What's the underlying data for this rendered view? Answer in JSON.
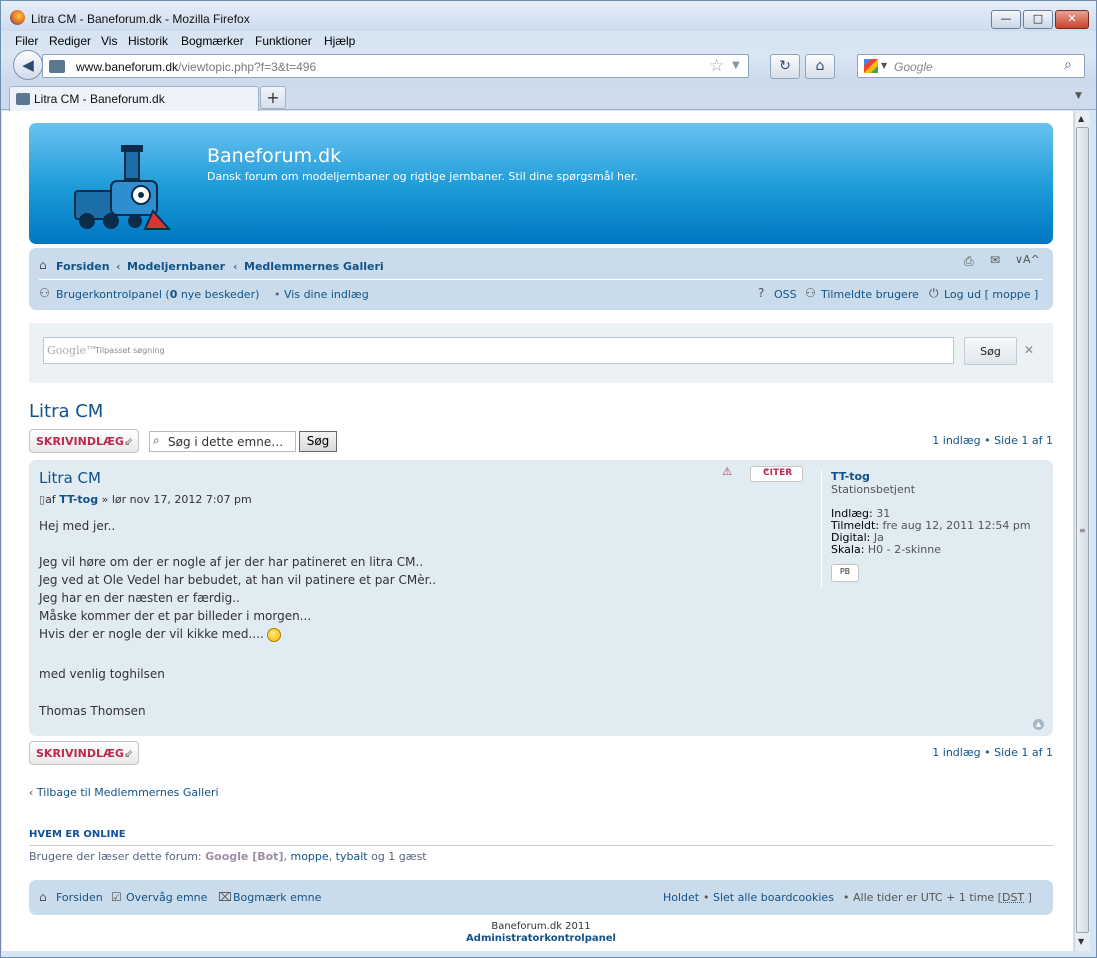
{
  "window": {
    "title": "Litra CM - Baneforum.dk - Mozilla Firefox",
    "min": "—",
    "max": "□",
    "close": "✕"
  },
  "menu": {
    "items": [
      "Filer",
      "Rediger",
      "Vis",
      "Historik",
      "Bogmærker",
      "Funktioner",
      "Hjælp"
    ]
  },
  "nav": {
    "back": "◀",
    "url_domain": "www.baneforum.dk",
    "url_path": "/viewtopic.php?f=3&t=496",
    "reload": "↻",
    "home": "⌂",
    "search_placeholder": "Google"
  },
  "tabs": {
    "active_label": "Litra CM - Baneforum.dk",
    "new_tab": "+"
  },
  "header": {
    "site_name": "Baneforum.dk",
    "site_desc": "Dansk forum om modeljernbaner og rigtige jernbaner. Stil dine spørgsmål her."
  },
  "breadcrumb": {
    "home": "Forsiden",
    "sep": "‹",
    "cat": "Modeljernbaner",
    "forum": "Medlemmernes Galleri"
  },
  "navlinks": {
    "ucp_pre": "Brugerkontrolpanel (",
    "ucp_count": "0",
    "ucp_post": " nye beskeder)",
    "bullet": "•",
    "own_posts": "Vis dine indlæg",
    "faq": "OSS",
    "members": "Tilmeldte brugere",
    "logout": "Log ud [ moppe ]"
  },
  "gsearch": {
    "brand": "Google™",
    "placeholder": "Tilpasset søgning",
    "button": "Søg",
    "clear": "✕"
  },
  "topic": {
    "title": "Litra CM"
  },
  "post_button": "SKRIVINDLÆG",
  "topic_search": {
    "value": "Søg i dette emne…",
    "button": "Søg"
  },
  "pagination": "1 indlæg • Side 1 af 1",
  "post": {
    "title": "Litra CM",
    "meta_pre": "af",
    "author": "TT-tog",
    "meta_post": "» lør nov 17, 2012 7:07 pm",
    "quote_label": "CITER",
    "lines": [
      "Hej med jer..",
      "Jeg vil høre om der er nogle af jer der har patineret en litra CM..",
      "Jeg ved at Ole Vedel har bebudet, at han vil patinere et par CMèr..",
      "Jeg har en der næsten er færdig..",
      "Måske kommer der et par billeder i morgen...",
      "Hvis der er nogle der vil kikke med....",
      "med venlig toghilsen",
      "Thomas Thomsen"
    ]
  },
  "profile": {
    "name": "TT-tog",
    "rank": "Stationsbetjent",
    "posts_label": "Indlæg:",
    "posts": "31",
    "joined_label": "Tilmeldt:",
    "joined": "fre aug 12, 2011 12:54 pm",
    "digital_label": "Digital:",
    "digital": "Ja",
    "scale_label": "Skala:",
    "scale": "H0 - 2-skinne",
    "pm": "PB"
  },
  "back_link": "Tilbage til Medlemmernes Galleri",
  "online": {
    "heading": "HVEM ER ONLINE",
    "pre": "Brugere der læser dette forum: ",
    "bot": "Google [Bot]",
    "comma1": ", ",
    "user1": "moppe",
    "comma2": ", ",
    "user2": "tybalt",
    "post": " og 1 gæst"
  },
  "footer": {
    "home": "Forsiden",
    "watch": "Overvåg emne",
    "bookmark": "Bogmærk emne",
    "team": "Holdet",
    "bullet": "•",
    "cookies": "Slet alle boardcookies",
    "tz": "• Alle tider er UTC + 1 time [",
    "dst": "DST",
    "tz_end": "]",
    "copyright": "Baneforum.dk 2011",
    "acp": "Administratorkontrolpanel"
  },
  "colors": {
    "accent": "#105289",
    "header": "#1b9ad8",
    "panel": "#cadceb",
    "post_bg": "#e1ebf2",
    "button_text": "#bc2a4d"
  }
}
